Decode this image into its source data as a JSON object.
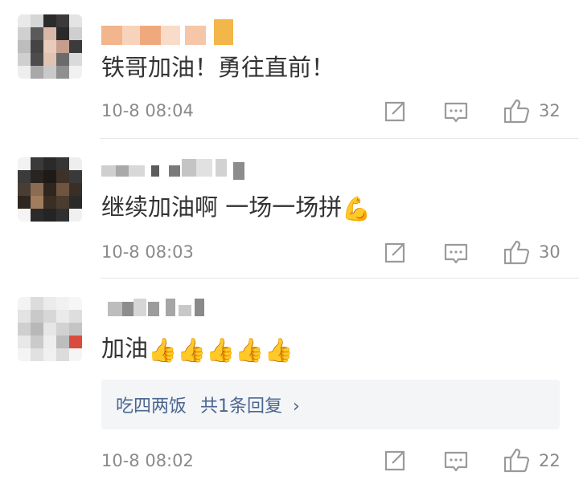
{
  "comments": [
    {
      "text": "铁哥加油！勇往直前！",
      "time": "10-8 08:04",
      "likes": "32"
    },
    {
      "text": "继续加油啊 一场一场拼",
      "emoji": "💪",
      "time": "10-8 08:03",
      "likes": "30"
    },
    {
      "text": "加油",
      "emoji": "👍👍👍👍👍",
      "time": "10-8 08:02",
      "likes": "22",
      "reply_summary": {
        "name": "吃四两饭",
        "label": "共1条回复",
        "arrow": "›"
      }
    }
  ],
  "icons": {
    "share": "share-icon",
    "comment": "comment-icon",
    "like": "thumbs-up-icon"
  },
  "colors": {
    "link": "#4a6690",
    "meta": "#8a8a8a",
    "text": "#333333"
  }
}
